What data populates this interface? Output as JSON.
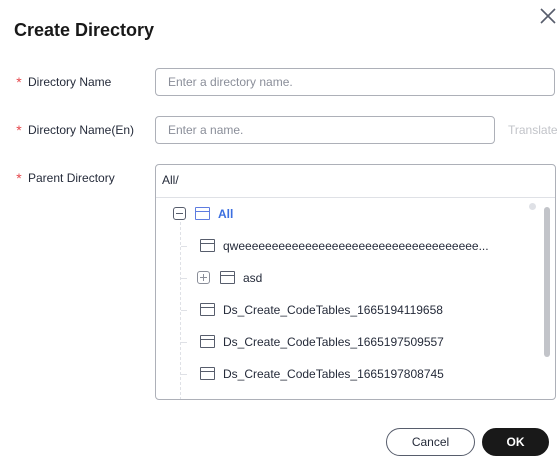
{
  "dialog": {
    "title": "Create Directory",
    "required_mark": "*"
  },
  "form": {
    "directory_name": {
      "label": "Directory Name",
      "placeholder": "Enter a directory name.",
      "value": ""
    },
    "directory_name_en": {
      "label": "Directory Name(En)",
      "placeholder": "Enter a name.",
      "value": "",
      "translate_label": "Translate"
    },
    "parent_directory": {
      "label": "Parent Directory",
      "path": "All/"
    }
  },
  "tree": {
    "root": {
      "label": "All",
      "expanded": true
    },
    "nodes": [
      {
        "label": "qweeeeeeeeeeeeeeeeeeeeeeeeeeeeeeeeeeee...",
        "has_children": false
      },
      {
        "label": "asd",
        "has_children": true,
        "expanded": false
      },
      {
        "label": "Ds_Create_CodeTables_1665194119658",
        "has_children": false
      },
      {
        "label": "Ds_Create_CodeTables_1665197509557",
        "has_children": false
      },
      {
        "label": "Ds_Create_CodeTables_1665197808745",
        "has_children": false
      }
    ]
  },
  "footer": {
    "cancel_label": "Cancel",
    "ok_label": "OK"
  },
  "colors": {
    "required": "#e5484d",
    "root_link": "#3b6fe0",
    "primary_button": "#191919"
  },
  "icons": {
    "close": "close-icon",
    "collapse": "collapse-icon",
    "expand": "expand-icon",
    "folder": "folder-icon"
  }
}
